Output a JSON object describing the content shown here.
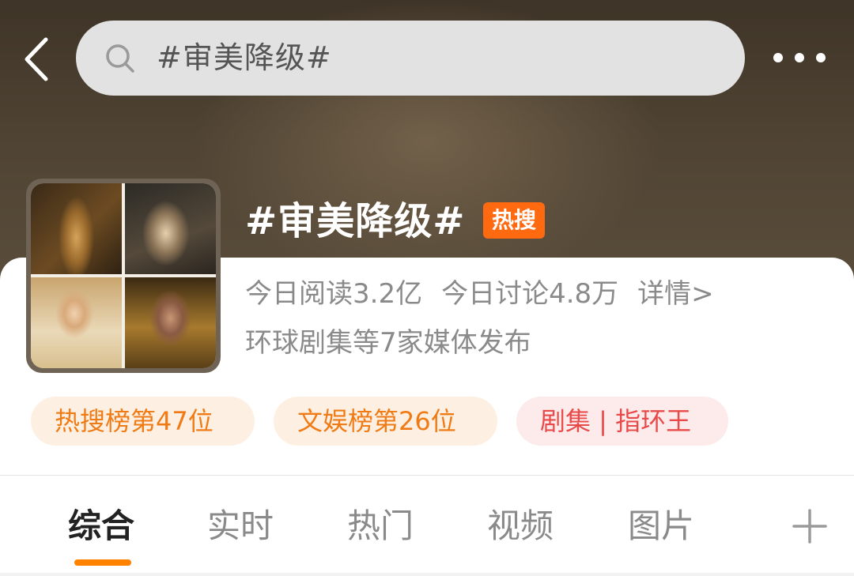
{
  "header": {
    "back_icon": "chevron-left-icon",
    "search": {
      "icon": "search-icon",
      "query": "#审美降级#"
    },
    "more_icon": "more-horizontal-icon"
  },
  "topic": {
    "title": "#审美降级#",
    "badge": "热搜",
    "badge_color": "#ff6a10",
    "reads": "今日阅读3.2亿",
    "discussions": "今日讨论4.8万",
    "details_link": "详情>",
    "source": "环球剧集等7家媒体发布"
  },
  "tags": [
    {
      "label": "热搜榜第47位",
      "color": "#f07a14"
    },
    {
      "label": "文娱榜第26位",
      "color": "#f07a14"
    },
    {
      "label": "剧集 | 指环王",
      "color": "#e84a4a"
    }
  ],
  "tabs": [
    {
      "label": "综合",
      "active": true
    },
    {
      "label": "实时",
      "active": false
    },
    {
      "label": "热门",
      "active": false
    },
    {
      "label": "视频",
      "active": false
    },
    {
      "label": "图片",
      "active": false
    }
  ],
  "add_tab_icon": "plus-icon",
  "accent_color": "#ff8200"
}
